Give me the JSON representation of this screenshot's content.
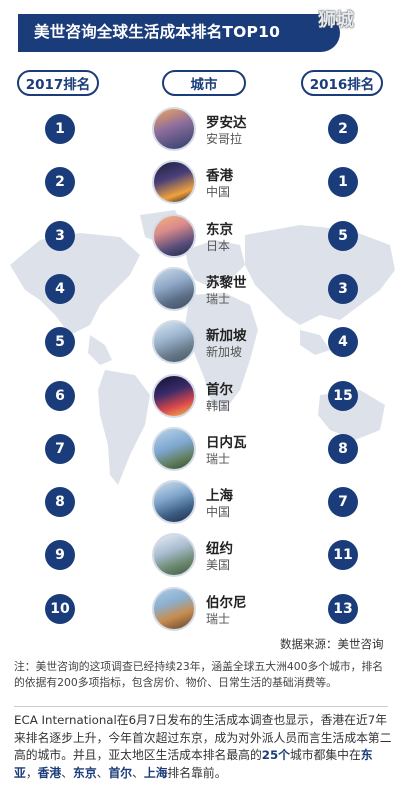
{
  "title": "美世咨询全球生活成本排名TOP10",
  "watermark": "狮城",
  "headers": {
    "rank_2017": "2017排名",
    "city": "城市",
    "rank_2016": "2016排名"
  },
  "rankings": [
    {
      "rank2017": "1",
      "city": "罗安达",
      "country": "安哥拉",
      "rank2016": "2"
    },
    {
      "rank2017": "2",
      "city": "香港",
      "country": "中国",
      "rank2016": "1"
    },
    {
      "rank2017": "3",
      "city": "东京",
      "country": "日本",
      "rank2016": "5"
    },
    {
      "rank2017": "4",
      "city": "苏黎世",
      "country": "瑞士",
      "rank2016": "3"
    },
    {
      "rank2017": "5",
      "city": "新加坡",
      "country": "新加坡",
      "rank2016": "4"
    },
    {
      "rank2017": "6",
      "city": "首尔",
      "country": "韩国",
      "rank2016": "15"
    },
    {
      "rank2017": "7",
      "city": "日内瓦",
      "country": "瑞士",
      "rank2016": "8"
    },
    {
      "rank2017": "8",
      "city": "上海",
      "country": "中国",
      "rank2016": "7"
    },
    {
      "rank2017": "9",
      "city": "纽约",
      "country": "美国",
      "rank2016": "11"
    },
    {
      "rank2017": "10",
      "city": "伯尔尼",
      "country": "瑞士",
      "rank2016": "13"
    }
  ],
  "source": "数据来源：美世咨询",
  "note": "注：美世咨询的这项调查已经持续23年，涵盖全球五大洲400多个城市，排名的依据有200多项指标，包含房价、物价、日常生活的基础消费等。",
  "eca": {
    "text1": "ECA International在6月7日发布的生活成本调查也显示，香港在近7年来排名逐步上升，今年首次超过东京，成为对外派人员而言生活成本第二高的城市。并且，亚太地区生活成本排名最高的",
    "count": "25个",
    "text2": "城市都集中在",
    "east_asia": "东亚",
    "sep1": "，",
    "hongkong": "香港",
    "sep2": "、",
    "tokyo": "东京",
    "sep3": "、",
    "seoul": "首尔",
    "sep4": "、",
    "shanghai": "上海",
    "text3": "排名靠前。"
  },
  "colors": {
    "brand": "#1b3c7a",
    "map": "#dde2ea"
  }
}
